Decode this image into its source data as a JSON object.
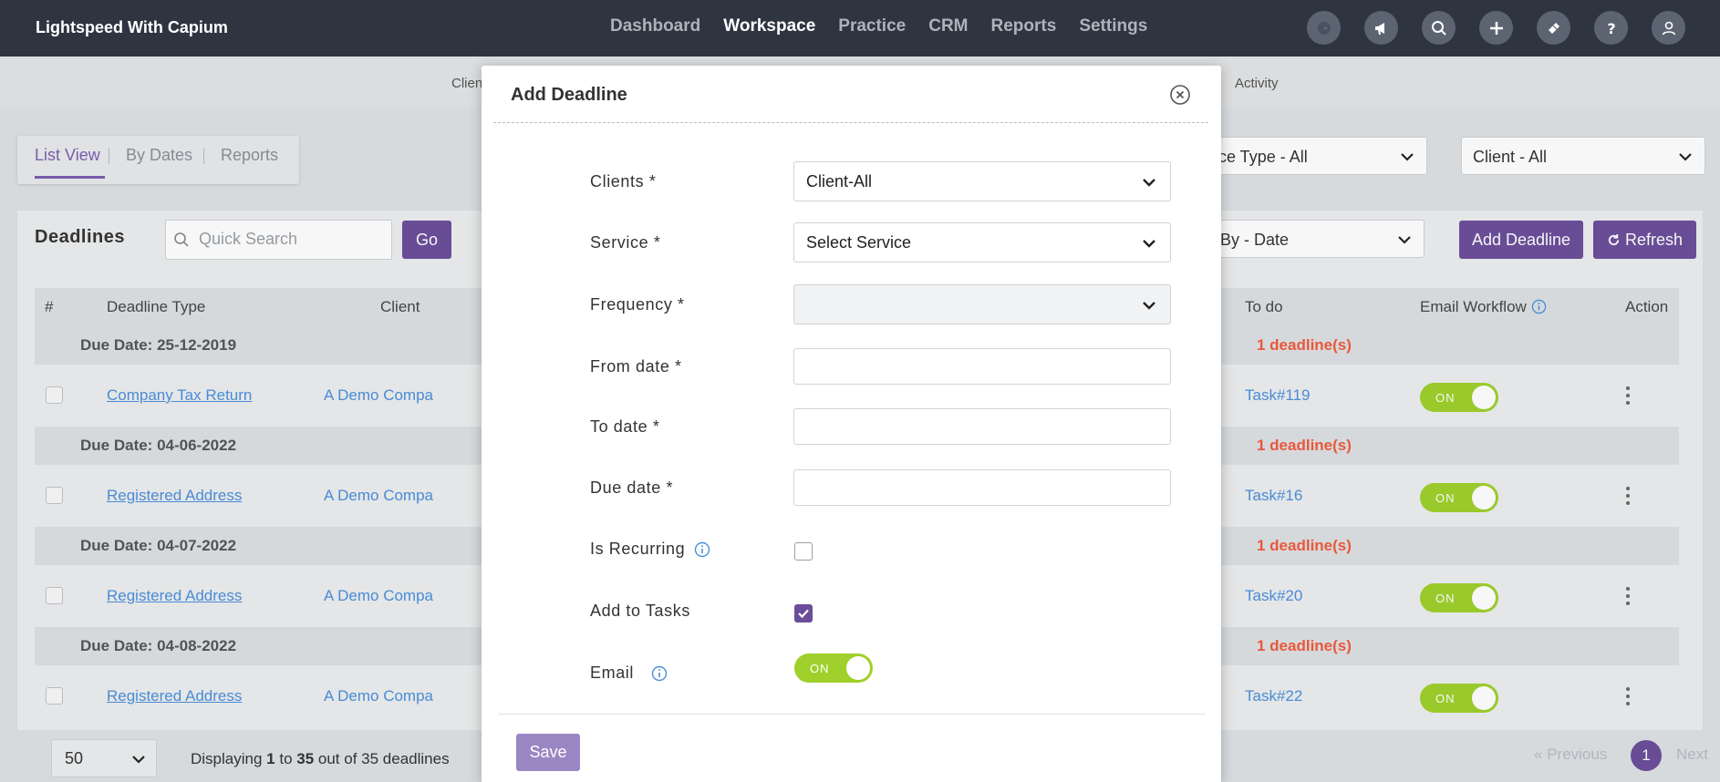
{
  "app": {
    "brand": "Lightspeed With Capium",
    "nav": [
      "Dashboard",
      "Workspace",
      "Practice",
      "CRM",
      "Reports",
      "Settings"
    ],
    "active_nav": "Workspace",
    "top_icons": [
      "google-icon",
      "megaphone-icon",
      "search-icon",
      "plus-icon",
      "ticket-icon",
      "help-icon",
      "user-icon"
    ]
  },
  "subnav": {
    "left_partial": "Clien",
    "right": "Activity"
  },
  "view_tabs": [
    "List View",
    "By Dates",
    "Reports"
  ],
  "filters": {
    "service_type": "vice Type - All",
    "client": "Client - All",
    "group_by": "p By - Date"
  },
  "toolbar": {
    "title": "Deadlines",
    "search_placeholder": "Quick Search",
    "go_label": "Go",
    "add_label": "Add Deadline",
    "refresh_label": "Refresh"
  },
  "table": {
    "headers": {
      "num": "#",
      "type": "Deadline Type",
      "client": "Client",
      "todo": "To do",
      "workflow": "Email Workflow",
      "action": "Action"
    },
    "groups": [
      {
        "due": "Due Date: 25-12-2019",
        "count": "1 deadline(s)",
        "row": {
          "type": "Company Tax Return",
          "client": "A Demo Compa",
          "task": "Task#119",
          "toggle": "ON"
        }
      },
      {
        "due": "Due Date: 04-06-2022",
        "count": "1 deadline(s)",
        "row": {
          "type": "Registered Address",
          "client": "A Demo Compa",
          "task": "Task#16",
          "toggle": "ON"
        }
      },
      {
        "due": "Due Date: 04-07-2022",
        "count": "1 deadline(s)",
        "row": {
          "type": "Registered Address",
          "client": "A Demo Compa",
          "task": "Task#20",
          "toggle": "ON"
        }
      },
      {
        "due": "Due Date: 04-08-2022",
        "count": "1 deadline(s)",
        "row": {
          "type": "Registered Address",
          "client": "A Demo Compa",
          "task": "Task#22",
          "toggle": "ON"
        }
      }
    ]
  },
  "footer": {
    "page_size": "50",
    "displaying_prefix": "Displaying ",
    "from": "1",
    "to_word": " to ",
    "to": "35",
    "suffix": " out of 35 deadlines",
    "prev": "Previous",
    "page": "1",
    "next": "Next"
  },
  "modal": {
    "title": "Add Deadline",
    "fields": {
      "clients": {
        "label": "Clients *",
        "value": "Client-All"
      },
      "service": {
        "label": "Service *",
        "value": "Select Service"
      },
      "frequency": {
        "label": "Frequency *",
        "value": ""
      },
      "from_date": {
        "label": "From date *",
        "value": ""
      },
      "to_date": {
        "label": "To date *",
        "value": ""
      },
      "due_date": {
        "label": "Due date *",
        "value": ""
      },
      "is_recurring": {
        "label": "Is Recurring",
        "checked": false
      },
      "add_to_tasks": {
        "label": "Add to Tasks",
        "checked": true
      },
      "email": {
        "label": "Email",
        "toggle": "ON"
      }
    },
    "save_label": "Save"
  },
  "colors": {
    "navbar": "#2e3440",
    "accent": "#6b4e9a",
    "toggle_on": "#9fd02b",
    "link": "#4a8fdc",
    "count": "#f05a3c"
  }
}
